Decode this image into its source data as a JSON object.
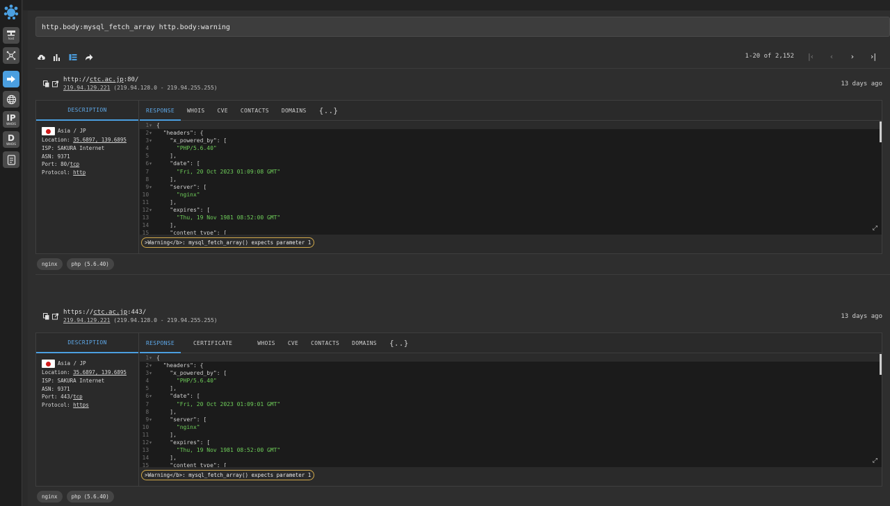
{
  "search": {
    "query": "http.body:mysql_fetch_array http.body:warning"
  },
  "pager": {
    "range": "1-20 of 2,152"
  },
  "sidebar": {
    "items": [
      {
        "label": "host"
      },
      {
        "label": ""
      },
      {
        "label": ""
      },
      {
        "label": ""
      },
      {
        "label": "IP",
        "sub": "WHOIS"
      },
      {
        "label": "D",
        "sub": "WHOIS"
      },
      {
        "label": ""
      }
    ]
  },
  "icons": {
    "toolbar": [
      "download-cloud-icon",
      "bar-chart-icon",
      "list-view-icon",
      "share-icon"
    ],
    "pager": [
      "first-page-icon",
      "prev-page-icon",
      "next-page-icon",
      "last-page-icon"
    ]
  },
  "results": [
    {
      "url_prefix": "http://",
      "url_host": "ctc.ac.jp",
      "url_suffix": ":80/",
      "ip": "219.94.129.221",
      "ip_range": "(219.94.128.0 - 219.94.255.255)",
      "ago": "13 days ago",
      "desc_tab": "DESCRIPTION",
      "region": "Asia / JP",
      "location_label": "Location: ",
      "location": "35.6897, 139.6895",
      "isp": "ISP: SAKURA Internet",
      "asn": "ASN: 9371",
      "port_label": "Port: 80/",
      "port_proto": "tcp",
      "protocol_label": "Protocol: ",
      "protocol": "http",
      "tabs": [
        "RESPONSE",
        "WHOIS",
        "CVE",
        "CONTACTS",
        "DOMAINS",
        "{..}"
      ],
      "code": [
        "{",
        "  \"headers\": {",
        "    \"x_powered_by\": [",
        "      \"PHP/5.6.40\"",
        "    ],",
        "    \"date\": [",
        "      \"Fri, 20 Oct 2023 01:09:08 GMT\"",
        "    ],",
        "    \"server\": [",
        "      \"nginx\"",
        "    ],",
        "    \"expires\": [",
        "      \"Thu, 19 Nov 1981 08:52:00 GMT\"",
        "    ],",
        "    \"content_type\": ["
      ],
      "warning": ">Warning</b>: mysql_fetch_array() expects parameter 1",
      "chips": [
        "nginx",
        "php (5.6.40)"
      ]
    },
    {
      "url_prefix": "https://",
      "url_host": "ctc.ac.jp",
      "url_suffix": ":443/",
      "ip": "219.94.129.221",
      "ip_range": "(219.94.128.0 - 219.94.255.255)",
      "ago": "13 days ago",
      "desc_tab": "DESCRIPTION",
      "region": "Asia / JP",
      "location_label": "Location: ",
      "location": "35.6897, 139.6895",
      "isp": "ISP: SAKURA Internet",
      "asn": "ASN: 9371",
      "port_label": "Port: 443/",
      "port_proto": "tcp",
      "protocol_label": "Protocol: ",
      "protocol": "https",
      "tabs": [
        "RESPONSE",
        "CERTIFICATE",
        "WHOIS",
        "CVE",
        "CONTACTS",
        "DOMAINS",
        "{..}"
      ],
      "code": [
        "{",
        "  \"headers\": {",
        "    \"x_powered_by\": [",
        "      \"PHP/5.6.40\"",
        "    ],",
        "    \"date\": [",
        "      \"Fri, 20 Oct 2023 01:09:01 GMT\"",
        "    ],",
        "    \"server\": [",
        "      \"nginx\"",
        "    ],",
        "    \"expires\": [",
        "      \"Thu, 19 Nov 1981 08:52:00 GMT\"",
        "    ],",
        "    \"content_type\": ["
      ],
      "warning": ">Warning</b>: mysql_fetch_array() expects parameter 1",
      "chips": [
        "nginx",
        "php (5.6.40)"
      ]
    }
  ],
  "colors": {
    "accent": "#4b9fe0",
    "string": "#6fcf5a",
    "warning_border": "#d2a94a"
  }
}
